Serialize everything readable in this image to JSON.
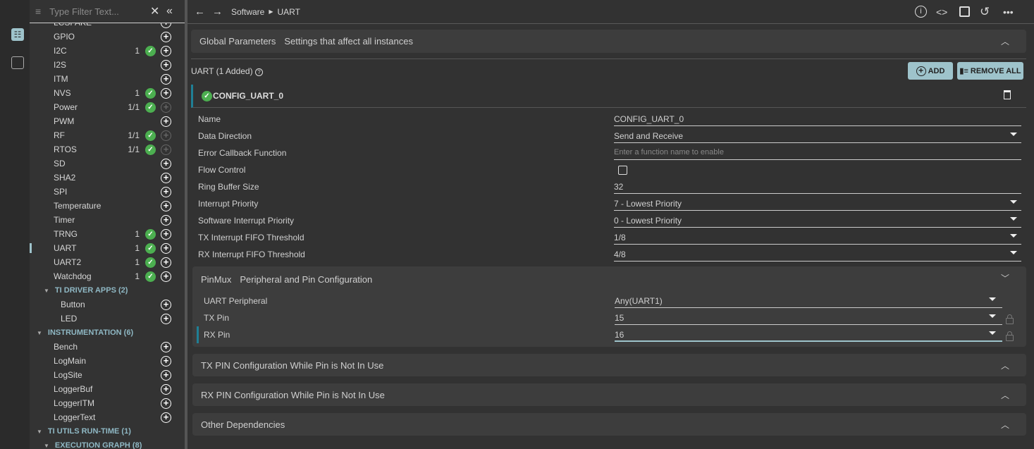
{
  "sidebar": {
    "filter_placeholder": "Type Filter Text...",
    "items": [
      {
        "label": "LCSFAKE",
        "count": "",
        "check": false,
        "add_enabled": true
      },
      {
        "label": "GPIO",
        "count": "",
        "check": false,
        "add_enabled": true
      },
      {
        "label": "I2C",
        "count": "1",
        "check": true,
        "add_enabled": true
      },
      {
        "label": "I2S",
        "count": "",
        "check": false,
        "add_enabled": true
      },
      {
        "label": "ITM",
        "count": "",
        "check": false,
        "add_enabled": true
      },
      {
        "label": "NVS",
        "count": "1",
        "check": true,
        "add_enabled": true
      },
      {
        "label": "Power",
        "count": "1/1",
        "check": true,
        "add_enabled": false
      },
      {
        "label": "PWM",
        "count": "",
        "check": false,
        "add_enabled": true
      },
      {
        "label": "RF",
        "count": "1/1",
        "check": true,
        "add_enabled": false
      },
      {
        "label": "RTOS",
        "count": "1/1",
        "check": true,
        "add_enabled": false
      },
      {
        "label": "SD",
        "count": "",
        "check": false,
        "add_enabled": true
      },
      {
        "label": "SHA2",
        "count": "",
        "check": false,
        "add_enabled": true
      },
      {
        "label": "SPI",
        "count": "",
        "check": false,
        "add_enabled": true
      },
      {
        "label": "Temperature",
        "count": "",
        "check": false,
        "add_enabled": true
      },
      {
        "label": "Timer",
        "count": "",
        "check": false,
        "add_enabled": true
      },
      {
        "label": "TRNG",
        "count": "1",
        "check": true,
        "add_enabled": true
      },
      {
        "label": "UART",
        "count": "1",
        "check": true,
        "add_enabled": true,
        "selected": true
      },
      {
        "label": "UART2",
        "count": "1",
        "check": true,
        "add_enabled": true
      },
      {
        "label": "Watchdog",
        "count": "1",
        "check": true,
        "add_enabled": true
      }
    ],
    "groups": [
      {
        "label": "TI DRIVER APPS (2)",
        "items": [
          "Button",
          "LED"
        ]
      },
      {
        "label": "INSTRUMENTATION (6)",
        "items": [
          "Bench",
          "LogMain",
          "LogSite",
          "LoggerBuf",
          "LoggerITM",
          "LoggerText"
        ]
      },
      {
        "label": "TI UTILS RUN-TIME (1)",
        "items": []
      },
      {
        "label": "EXECUTION GRAPH (8)",
        "items": []
      }
    ]
  },
  "breadcrumb": [
    "Software",
    "UART"
  ],
  "global": {
    "title": "Global Parameters",
    "subtitle": "Settings that affect all instances"
  },
  "module": {
    "title": "UART (1 Added)",
    "add_label": "ADD",
    "remove_all_label": "REMOVE ALL",
    "instance": "CONFIG_UART_0"
  },
  "params": [
    {
      "label": "Name",
      "value": "CONFIG_UART_0",
      "type": "text"
    },
    {
      "label": "Data Direction",
      "value": "Send and Receive",
      "type": "select"
    },
    {
      "label": "Error Callback Function",
      "value": "",
      "placeholder": "Enter a function name to enable",
      "type": "text"
    },
    {
      "label": "Flow Control",
      "value": false,
      "type": "checkbox"
    },
    {
      "label": "Ring Buffer Size",
      "value": "32",
      "type": "text"
    },
    {
      "label": "Interrupt Priority",
      "value": "7 - Lowest Priority",
      "type": "select"
    },
    {
      "label": "Software Interrupt Priority",
      "value": "0 - Lowest Priority",
      "type": "select"
    },
    {
      "label": "TX Interrupt FIFO Threshold",
      "value": "1/8",
      "type": "select"
    },
    {
      "label": "RX Interrupt FIFO Threshold",
      "value": "4/8",
      "type": "select"
    }
  ],
  "pinmux": {
    "title": "PinMux",
    "subtitle": "Peripheral and Pin Configuration",
    "rows": [
      {
        "label": "UART Peripheral",
        "value": "Any(UART1)",
        "lock": false
      },
      {
        "label": "TX Pin",
        "value": "15",
        "lock": true
      },
      {
        "label": "RX Pin",
        "value": "16",
        "lock": true,
        "focused": true
      }
    ]
  },
  "sections": [
    "TX PIN Configuration While Pin is Not In Use",
    "RX PIN Configuration While Pin is Not In Use",
    "Other Dependencies"
  ],
  "colors": {
    "accent": "#9ec3cb",
    "check": "#4caf50",
    "teal_marker": "#1f7f95"
  }
}
